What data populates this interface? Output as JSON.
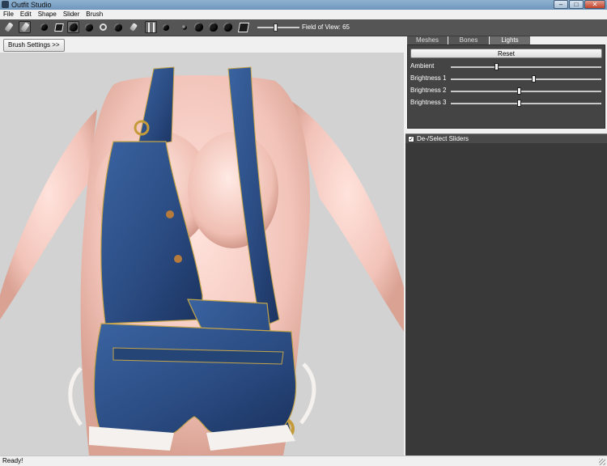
{
  "window": {
    "title": "Outfit Studio",
    "min": "–",
    "max": "□",
    "close": "✕"
  },
  "menu": [
    "File",
    "Edit",
    "Shape",
    "Slider",
    "Brush"
  ],
  "toolbar": {
    "fov_label": "Field of View: 65",
    "fov_value": 65
  },
  "viewport": {
    "brush_settings_label": "Brush Settings >>"
  },
  "tabs": [
    {
      "label": "Meshes",
      "active": false
    },
    {
      "label": "Bones",
      "active": false
    },
    {
      "label": "Lights",
      "active": true
    }
  ],
  "lights": {
    "reset_label": "Reset",
    "controls": [
      {
        "label": "Ambient",
        "value": 0.3
      },
      {
        "label": "Brightness 1",
        "value": 0.55
      },
      {
        "label": "Brightness 2",
        "value": 0.45
      },
      {
        "label": "Brightness 3",
        "value": 0.45
      }
    ]
  },
  "sliders": {
    "select_label": "De-/Select Sliders",
    "checked": true,
    "check_glyph": "✓"
  },
  "status": {
    "text": "Ready!"
  },
  "colors": {
    "toolbar_bg": "#555555",
    "panel_bg": "#444444",
    "denim": "#2c4f86"
  }
}
